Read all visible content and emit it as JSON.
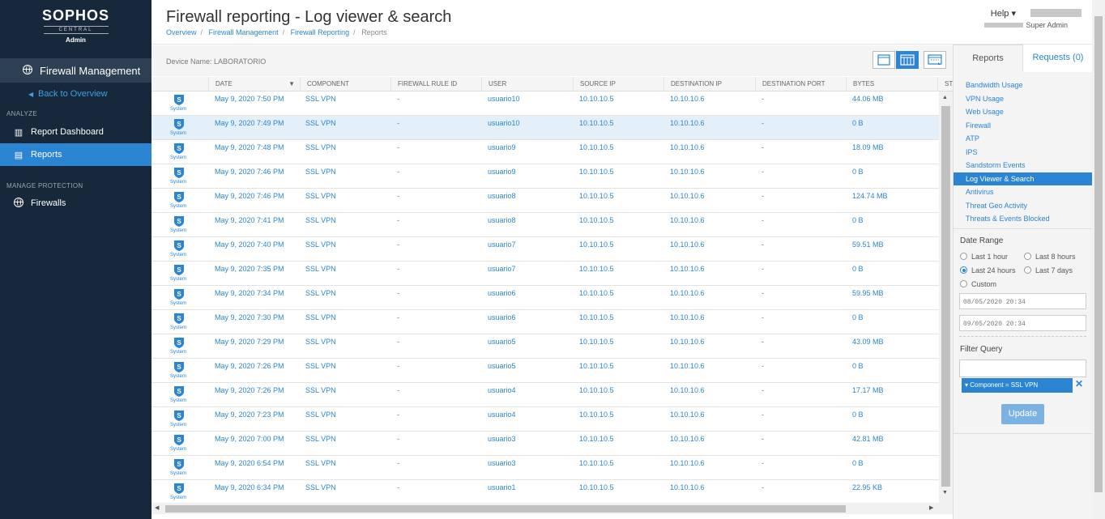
{
  "brand": {
    "name": "SOPHOS",
    "sub": "CENTRAL",
    "role": "Admin"
  },
  "sidebar": {
    "section_title": "Firewall Management",
    "back": "Back to Overview",
    "analyze": "ANALYZE",
    "report_dashboard": "Report Dashboard",
    "reports": "Reports",
    "manage": "MANAGE PROTECTION",
    "firewalls": "Firewalls"
  },
  "header": {
    "title": "Firewall reporting - Log viewer & search",
    "crumbs": [
      "Overview",
      "Firewall Management",
      "Firewall Reporting",
      "Reports"
    ],
    "help": "Help ▾",
    "user_role": "Super Admin"
  },
  "device": {
    "label": "Device Name: LABORATORIO"
  },
  "table": {
    "columns": [
      "DATE",
      "COMPONENT",
      "FIREWALL RULE ID",
      "USER",
      "SOURCE IP",
      "DESTINATION IP",
      "DESTINATION PORT",
      "BYTES",
      "ST"
    ],
    "icon_label": "System",
    "rows": [
      {
        "date": "May 9, 2020 7:50 PM",
        "component": "SSL VPN",
        "rule": "-",
        "user": "usuario10",
        "src": "10.10.10.5",
        "dst": "10.10.10.6",
        "port": "-",
        "bytes": "44.06 MB"
      },
      {
        "date": "May 9, 2020 7:49 PM",
        "component": "SSL VPN",
        "rule": "-",
        "user": "usuario10",
        "src": "10.10.10.5",
        "dst": "10.10.10.6",
        "port": "-",
        "bytes": "0 B"
      },
      {
        "date": "May 9, 2020 7:48 PM",
        "component": "SSL VPN",
        "rule": "-",
        "user": "usuario9",
        "src": "10.10.10.5",
        "dst": "10.10.10.6",
        "port": "-",
        "bytes": "18.09 MB"
      },
      {
        "date": "May 9, 2020 7:46 PM",
        "component": "SSL VPN",
        "rule": "-",
        "user": "usuario9",
        "src": "10.10.10.5",
        "dst": "10.10.10.6",
        "port": "-",
        "bytes": "0 B"
      },
      {
        "date": "May 9, 2020 7:46 PM",
        "component": "SSL VPN",
        "rule": "-",
        "user": "usuario8",
        "src": "10.10.10.5",
        "dst": "10.10.10.6",
        "port": "-",
        "bytes": "124.74 MB"
      },
      {
        "date": "May 9, 2020 7:41 PM",
        "component": "SSL VPN",
        "rule": "-",
        "user": "usuario8",
        "src": "10.10.10.5",
        "dst": "10.10.10.6",
        "port": "-",
        "bytes": "0 B"
      },
      {
        "date": "May 9, 2020 7:40 PM",
        "component": "SSL VPN",
        "rule": "-",
        "user": "usuario7",
        "src": "10.10.10.5",
        "dst": "10.10.10.6",
        "port": "-",
        "bytes": "59.51 MB"
      },
      {
        "date": "May 9, 2020 7:35 PM",
        "component": "SSL VPN",
        "rule": "-",
        "user": "usuario7",
        "src": "10.10.10.5",
        "dst": "10.10.10.6",
        "port": "-",
        "bytes": "0 B"
      },
      {
        "date": "May 9, 2020 7:34 PM",
        "component": "SSL VPN",
        "rule": "-",
        "user": "usuario6",
        "src": "10.10.10.5",
        "dst": "10.10.10.6",
        "port": "-",
        "bytes": "59.95 MB"
      },
      {
        "date": "May 9, 2020 7:30 PM",
        "component": "SSL VPN",
        "rule": "-",
        "user": "usuario6",
        "src": "10.10.10.5",
        "dst": "10.10.10.6",
        "port": "-",
        "bytes": "0 B"
      },
      {
        "date": "May 9, 2020 7:29 PM",
        "component": "SSL VPN",
        "rule": "-",
        "user": "usuario5",
        "src": "10.10.10.5",
        "dst": "10.10.10.6",
        "port": "-",
        "bytes": "43.09 MB"
      },
      {
        "date": "May 9, 2020 7:26 PM",
        "component": "SSL VPN",
        "rule": "-",
        "user": "usuario5",
        "src": "10.10.10.5",
        "dst": "10.10.10.6",
        "port": "-",
        "bytes": "0 B"
      },
      {
        "date": "May 9, 2020 7:26 PM",
        "component": "SSL VPN",
        "rule": "-",
        "user": "usuario4",
        "src": "10.10.10.5",
        "dst": "10.10.10.6",
        "port": "-",
        "bytes": "17.17 MB"
      },
      {
        "date": "May 9, 2020 7:23 PM",
        "component": "SSL VPN",
        "rule": "-",
        "user": "usuario4",
        "src": "10.10.10.5",
        "dst": "10.10.10.6",
        "port": "-",
        "bytes": "0 B"
      },
      {
        "date": "May 9, 2020 7:00 PM",
        "component": "SSL VPN",
        "rule": "-",
        "user": "usuario3",
        "src": "10.10.10.5",
        "dst": "10.10.10.6",
        "port": "-",
        "bytes": "42.81 MB"
      },
      {
        "date": "May 9, 2020 6:54 PM",
        "component": "SSL VPN",
        "rule": "-",
        "user": "usuario3",
        "src": "10.10.10.5",
        "dst": "10.10.10.6",
        "port": "-",
        "bytes": "0 B"
      },
      {
        "date": "May 9, 2020 6:34 PM",
        "component": "SSL VPN",
        "rule": "-",
        "user": "usuario1",
        "src": "10.10.10.5",
        "dst": "10.10.10.6",
        "port": "-",
        "bytes": "22.95 KB"
      }
    ]
  },
  "right": {
    "tab_reports": "Reports",
    "tab_requests": "Requests (0)",
    "links": [
      "Bandwidth Usage",
      "VPN Usage",
      "Web Usage",
      "Firewall",
      "ATP",
      "IPS",
      "Sandstorm Events",
      "Log Viewer & Search",
      "Antivirus",
      "Threat Geo Activity",
      "Threats & Events Blocked"
    ],
    "date_range": "Date Range",
    "r1": "Last 1 hour",
    "r2": "Last 8 hours",
    "r3": "Last 24 hours",
    "r4": "Last 7 days",
    "r5": "Custom",
    "from": "08/05/2020 20:34",
    "to": "09/05/2020 20:34",
    "filter_query": "Filter Query",
    "chip": "▾ Component = SSL VPN",
    "chip_x": "✕",
    "update": "Update"
  },
  "colors": {
    "sidebar": "#17283a",
    "accent": "#2b85d2"
  }
}
